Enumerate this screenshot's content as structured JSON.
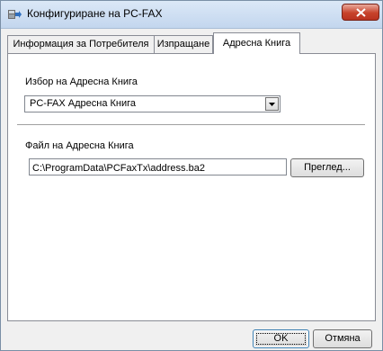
{
  "window": {
    "title": "Конфигуриране на PC-FAX",
    "icon": "pc-fax-app-icon",
    "close_icon": "close-icon",
    "accent": "#c7432b"
  },
  "tabs": [
    {
      "label": "Информация за Потребителя",
      "active": false
    },
    {
      "label": "Изпращане",
      "active": false
    },
    {
      "label": "Адресна Книга",
      "active": true
    }
  ],
  "address_book": {
    "select_label": "Избор на Адресна Книга",
    "selected_value": "PC-FAX Адресна Книга",
    "file_label": "Файл на Адресна Книга",
    "file_path": "C:\\ProgramData\\PCFaxTx\\address.ba2",
    "browse_label": "Преглед..."
  },
  "footer": {
    "ok_label": "OK",
    "cancel_label": "Отмяна"
  }
}
